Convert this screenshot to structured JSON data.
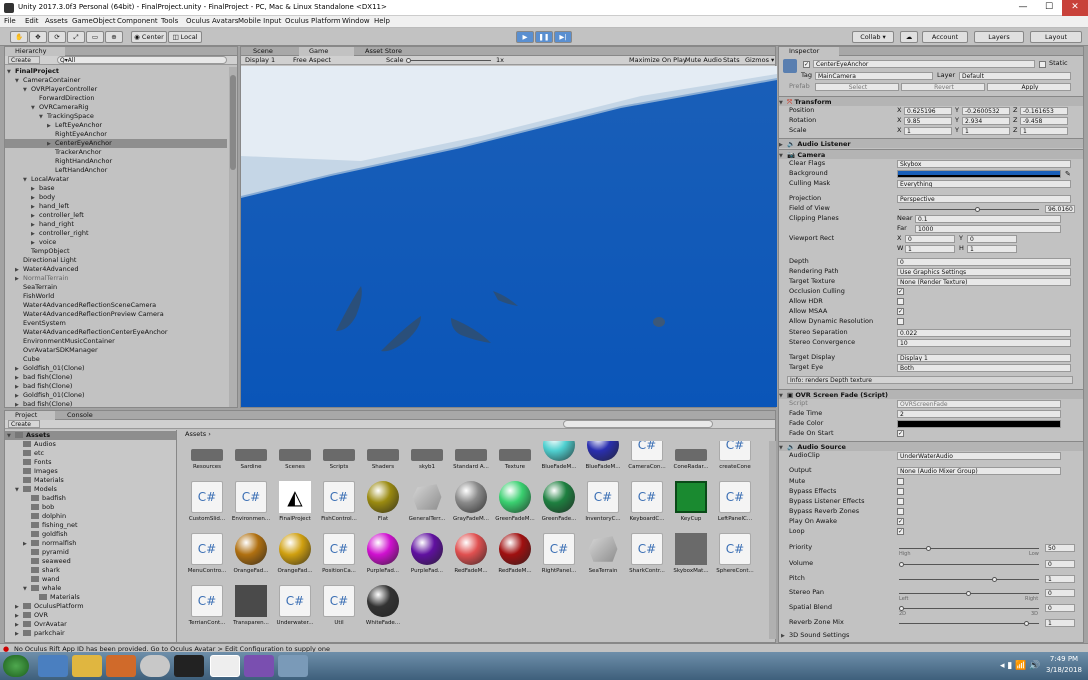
{
  "window": {
    "title": "Unity 2017.3.0f3 Personal (64bit) - FinalProject.unity - FinalProject - PC, Mac & Linux Standalone <DX11>",
    "minimize": "—",
    "maximize": "☐",
    "close": "✕"
  },
  "menu": [
    "File",
    "Edit",
    "Assets",
    "GameObject",
    "Component",
    "Tools",
    "Oculus Avatars",
    "Mobile Input",
    "Oculus Platform",
    "Window",
    "Help"
  ],
  "toolbar": {
    "center": "Center",
    "local": "Local",
    "collab": "Collab ▾",
    "account": "Account",
    "layers": "Layers",
    "layout": "Layout"
  },
  "hierarchy": {
    "tab": "Hierarchy",
    "create": "Create",
    "search": "Q▾All",
    "scene": "FinalProject",
    "rows": [
      {
        "label": "CameraContainer",
        "indent": 1,
        "arrow": "▼"
      },
      {
        "label": "OVRPlayerController",
        "indent": 2,
        "arrow": "▼"
      },
      {
        "label": "ForwardDirection",
        "indent": 3,
        "arrow": ""
      },
      {
        "label": "OVRCameraRig",
        "indent": 3,
        "arrow": "▼"
      },
      {
        "label": "TrackingSpace",
        "indent": 4,
        "arrow": "▼"
      },
      {
        "label": "LeftEyeAnchor",
        "indent": 5,
        "arrow": "▶"
      },
      {
        "label": "RightEyeAnchor",
        "indent": 5,
        "arrow": ""
      },
      {
        "label": "CenterEyeAnchor",
        "indent": 5,
        "arrow": "▶",
        "selected": true
      },
      {
        "label": "TrackerAnchor",
        "indent": 5,
        "arrow": ""
      },
      {
        "label": "RightHandAnchor",
        "indent": 5,
        "arrow": ""
      },
      {
        "label": "LeftHandAnchor",
        "indent": 5,
        "arrow": ""
      },
      {
        "label": "LocalAvatar",
        "indent": 2,
        "arrow": "▼"
      },
      {
        "label": "base",
        "indent": 3,
        "arrow": "▶"
      },
      {
        "label": "body",
        "indent": 3,
        "arrow": "▶"
      },
      {
        "label": "hand_left",
        "indent": 3,
        "arrow": "▶"
      },
      {
        "label": "controller_left",
        "indent": 3,
        "arrow": "▶"
      },
      {
        "label": "hand_right",
        "indent": 3,
        "arrow": "▶"
      },
      {
        "label": "controller_right",
        "indent": 3,
        "arrow": "▶"
      },
      {
        "label": "voice",
        "indent": 3,
        "arrow": "▶"
      },
      {
        "label": "TempObject",
        "indent": 2,
        "arrow": ""
      },
      {
        "label": "Directional Light",
        "indent": 1,
        "arrow": ""
      },
      {
        "label": "Water4Advanced",
        "indent": 1,
        "arrow": "▶"
      },
      {
        "label": "NormalTerrain",
        "indent": 1,
        "arrow": "▶",
        "dim": true
      },
      {
        "label": "SeaTerrain",
        "indent": 1,
        "arrow": ""
      },
      {
        "label": "FishWorld",
        "indent": 1,
        "arrow": ""
      },
      {
        "label": "Water4AdvancedReflectionSceneCamera",
        "indent": 1,
        "arrow": ""
      },
      {
        "label": "Water4AdvancedReflectionPreview Camera",
        "indent": 1,
        "arrow": ""
      },
      {
        "label": "EventSystem",
        "indent": 1,
        "arrow": ""
      },
      {
        "label": "Water4AdvancedReflectionCenterEyeAnchor",
        "indent": 1,
        "arrow": ""
      },
      {
        "label": "EnvironmentMusicContainer",
        "indent": 1,
        "arrow": ""
      },
      {
        "label": "OvrAvatarSDKManager",
        "indent": 1,
        "arrow": ""
      },
      {
        "label": "Cube",
        "indent": 1,
        "arrow": ""
      },
      {
        "label": "Goldfish_01(Clone)",
        "indent": 1,
        "arrow": "▶"
      },
      {
        "label": "bad fish(Clone)",
        "indent": 1,
        "arrow": "▶"
      },
      {
        "label": "bad fish(Clone)",
        "indent": 1,
        "arrow": "▶"
      },
      {
        "label": "Goldfish_01(Clone)",
        "indent": 1,
        "arrow": "▶"
      },
      {
        "label": "bad fish(Clone)",
        "indent": 1,
        "arrow": "▶"
      }
    ]
  },
  "viewport": {
    "tabs": [
      "Scene",
      "Game",
      "Asset Store"
    ],
    "display": "Display 1",
    "aspect": "Free Aspect",
    "scale_label": "Scale",
    "scale_value": "1x",
    "maximize": "Maximize On Play",
    "mute": "Mute Audio",
    "stats": "Stats",
    "gizmos": "Gizmos ▾"
  },
  "project": {
    "tabs": [
      "Project",
      "Console"
    ],
    "create": "Create",
    "breadcrumb": "Assets ›",
    "tree": [
      {
        "label": "Assets",
        "indent": 0,
        "arrow": "▼",
        "selected": true
      },
      {
        "label": "Audios",
        "indent": 1,
        "arrow": ""
      },
      {
        "label": "etc",
        "indent": 1,
        "arrow": ""
      },
      {
        "label": "Fonts",
        "indent": 1,
        "arrow": ""
      },
      {
        "label": "Images",
        "indent": 1,
        "arrow": ""
      },
      {
        "label": "Materials",
        "indent": 1,
        "arrow": ""
      },
      {
        "label": "Models",
        "indent": 1,
        "arrow": "▼"
      },
      {
        "label": "badfish",
        "indent": 2,
        "arrow": ""
      },
      {
        "label": "bob",
        "indent": 2,
        "arrow": ""
      },
      {
        "label": "dolphin",
        "indent": 2,
        "arrow": ""
      },
      {
        "label": "fishing_net",
        "indent": 2,
        "arrow": ""
      },
      {
        "label": "goldfish",
        "indent": 2,
        "arrow": ""
      },
      {
        "label": "normalfish",
        "indent": 2,
        "arrow": "▶"
      },
      {
        "label": "pyramid",
        "indent": 2,
        "arrow": ""
      },
      {
        "label": "seaweed",
        "indent": 2,
        "arrow": ""
      },
      {
        "label": "shark",
        "indent": 2,
        "arrow": ""
      },
      {
        "label": "wand",
        "indent": 2,
        "arrow": ""
      },
      {
        "label": "whale",
        "indent": 2,
        "arrow": "▼"
      },
      {
        "label": "Materials",
        "indent": 3,
        "arrow": ""
      },
      {
        "label": "OculusPlatform",
        "indent": 1,
        "arrow": "▶"
      },
      {
        "label": "OVR",
        "indent": 1,
        "arrow": "▶"
      },
      {
        "label": "OvrAvatar",
        "indent": 1,
        "arrow": "▶"
      },
      {
        "label": "parkchair",
        "indent": 1,
        "arrow": "▶"
      }
    ],
    "assets": [
      {
        "name": "Resources",
        "kind": "folder",
        "color": "#6a6a6a"
      },
      {
        "name": "Sardine",
        "kind": "folder",
        "color": "#6a6a6a"
      },
      {
        "name": "Scenes",
        "kind": "folder",
        "color": "#6a6a6a"
      },
      {
        "name": "Scripts",
        "kind": "folder",
        "color": "#6a6a6a"
      },
      {
        "name": "Shaders",
        "kind": "folder",
        "color": "#6a6a6a"
      },
      {
        "name": "skyb1",
        "kind": "folder",
        "color": "#6a6a6a"
      },
      {
        "name": "Standard A...",
        "kind": "folder",
        "color": "#6a6a6a"
      },
      {
        "name": "Texture",
        "kind": "folder",
        "color": "#6a6a6a"
      },
      {
        "name": "BlueFadeM...",
        "kind": "sphere",
        "color": "#4fd0d0"
      },
      {
        "name": "BlueFadeM...",
        "kind": "sphere",
        "color": "#2a2fb0"
      },
      {
        "name": "CameraCon...",
        "kind": "script",
        "color": "#f4f4f4"
      },
      {
        "name": "ConeRadar...",
        "kind": "folder",
        "color": "#6a6a6a"
      },
      {
        "name": "createCone",
        "kind": "script",
        "color": "#f4f4f4"
      },
      {
        "name": "CustomSlid...",
        "kind": "script",
        "color": "#f4f4f4"
      },
      {
        "name": "Environmen...",
        "kind": "script",
        "color": "#f4f4f4"
      },
      {
        "name": "FinalProject",
        "kind": "unity",
        "color": "#f4f4f4"
      },
      {
        "name": "FishControl...",
        "kind": "script",
        "color": "#f4f4f4"
      },
      {
        "name": "Flat",
        "kind": "sphere",
        "color": "#9a8a10"
      },
      {
        "name": "GeneralTerr...",
        "kind": "prefab",
        "color": "#b0b0b0"
      },
      {
        "name": "GrayFadeM...",
        "kind": "sphere",
        "color": "#8a8a8a"
      },
      {
        "name": "GreenFadeM...",
        "kind": "sphere",
        "color": "#3ad070"
      },
      {
        "name": "GreenFade...",
        "kind": "sphere",
        "color": "#1e8040"
      },
      {
        "name": "InventoryC...",
        "kind": "script",
        "color": "#f4f4f4"
      },
      {
        "name": "KeyboardC...",
        "kind": "script",
        "color": "#f4f4f4"
      },
      {
        "name": "KeyCup",
        "kind": "cube",
        "color": "#1a8a30"
      },
      {
        "name": "LeftPanelC...",
        "kind": "script",
        "color": "#f4f4f4"
      },
      {
        "name": "MenuContro...",
        "kind": "script",
        "color": "#f4f4f4"
      },
      {
        "name": "OrangeFad...",
        "kind": "sphere",
        "color": "#b07010"
      },
      {
        "name": "OrangeFad...",
        "kind": "sphere",
        "color": "#d0a010"
      },
      {
        "name": "PositionCa...",
        "kind": "script",
        "color": "#f4f4f4"
      },
      {
        "name": "PurpleFad...",
        "kind": "sphere",
        "color": "#d010d0"
      },
      {
        "name": "PurpleFad...",
        "kind": "sphere",
        "color": "#6010a0"
      },
      {
        "name": "RedFadeM...",
        "kind": "sphere",
        "color": "#e05050"
      },
      {
        "name": "RedFadeM...",
        "kind": "sphere",
        "color": "#a01010"
      },
      {
        "name": "RightPanel...",
        "kind": "script",
        "color": "#f4f4f4"
      },
      {
        "name": "SeaTerrain",
        "kind": "prefab",
        "color": "#b0b0b0"
      },
      {
        "name": "SharkContr...",
        "kind": "script",
        "color": "#f4f4f4"
      },
      {
        "name": "SkyboxMat...",
        "kind": "flat",
        "color": "#6a6a6a"
      },
      {
        "name": "SphereCont...",
        "kind": "script",
        "color": "#f4f4f4"
      },
      {
        "name": "TerrianCont...",
        "kind": "script",
        "color": "#f4f4f4"
      },
      {
        "name": "Transparen...",
        "kind": "flat",
        "color": "#4a4a4a"
      },
      {
        "name": "Underwater...",
        "kind": "script",
        "color": "#f4f4f4"
      },
      {
        "name": "Util",
        "kind": "script",
        "color": "#f4f4f4"
      },
      {
        "name": "WhiteFade...",
        "kind": "sphere",
        "color": "#333333"
      }
    ]
  },
  "inspector": {
    "tab": "Inspector",
    "name": "CenterEyeAnchor",
    "static": "Static",
    "tag_label": "Tag",
    "tag": "MainCamera",
    "layer_label": "Layer",
    "layer": "Default",
    "prefab": "Prefab",
    "select": "Select",
    "revert": "Revert",
    "apply": "Apply",
    "transform": {
      "title": "Transform",
      "position": "Position",
      "rotation": "Rotation",
      "scale": "Scale",
      "pos": [
        "0.625196",
        "-0.2600532",
        "-0.161653"
      ],
      "rot": [
        "9.85",
        "2.934",
        "-9.458"
      ],
      "scl": [
        "1",
        "1",
        "1"
      ]
    },
    "audio_listener": "Audio Listener",
    "camera": {
      "title": "Camera",
      "rows": [
        {
          "label": "Clear Flags",
          "value": "Skybox"
        },
        {
          "label": "Background",
          "value": ""
        },
        {
          "label": "Culling Mask",
          "value": "Everything"
        },
        {
          "label": "Projection",
          "value": "Perspective"
        },
        {
          "label": "Field of View",
          "value": "96.0160"
        },
        {
          "label": "Clipping Planes",
          "near_label": "Near",
          "near": "0.1",
          "far_label": "Far",
          "far": "1000"
        },
        {
          "label": "Viewport Rect",
          "x": "0",
          "y": "0",
          "w": "1",
          "h": "1"
        },
        {
          "label": "Depth",
          "value": "0"
        },
        {
          "label": "Rendering Path",
          "value": "Use Graphics Settings"
        },
        {
          "label": "Target Texture",
          "value": "None (Render Texture)"
        },
        {
          "label": "Occlusion Culling",
          "check": true
        },
        {
          "label": "Allow HDR",
          "check": false
        },
        {
          "label": "Allow MSAA",
          "check": true
        },
        {
          "label": "Allow Dynamic Resolution",
          "check": false
        },
        {
          "label": "Stereo Separation",
          "value": "0.022"
        },
        {
          "label": "Stereo Convergence",
          "value": "10"
        },
        {
          "label": "Target Display",
          "value": "Display 1"
        },
        {
          "label": "Target Eye",
          "value": "Both"
        }
      ],
      "info": "Info: renders Depth texture"
    },
    "fade": {
      "title": "OVR Screen Fade (Script)",
      "script_label": "Script",
      "script": "OVRScreenFade",
      "time_label": "Fade Time",
      "time": "2",
      "color_label": "Fade Color",
      "start_label": "Fade On Start"
    },
    "audio": {
      "title": "Audio Source",
      "clip_label": "AudioClip",
      "clip": "UnderWaterAudio",
      "output_label": "Output",
      "output": "None (Audio Mixer Group)",
      "checks": [
        {
          "label": "Mute",
          "check": false
        },
        {
          "label": "Bypass Effects",
          "check": false
        },
        {
          "label": "Bypass Listener Effects",
          "check": false
        },
        {
          "label": "Bypass Reverb Zones",
          "check": false
        },
        {
          "label": "Play On Awake",
          "check": true
        },
        {
          "label": "Loop",
          "check": true
        }
      ],
      "priority_label": "Priority",
      "priority": "50",
      "high": "High",
      "low": "Low",
      "volume_label": "Volume",
      "volume": "0",
      "pitch_label": "Pitch",
      "pitch": "1",
      "pan_label": "Stereo Pan",
      "pan": "0",
      "left": "Left",
      "right": "Right",
      "blend_label": "Spatial Blend",
      "blend": "0",
      "twod": "2D",
      "threed": "3D",
      "reverb_label": "Reverb Zone Mix",
      "reverb": "1",
      "sound3d": "3D Sound Settings"
    }
  },
  "status": "No Oculus Rift App ID has been provided. Go to Oculus Avatar > Edit Configuration to supply one",
  "taskbar": {
    "time": "7:49 PM",
    "date": "3/18/2018"
  }
}
